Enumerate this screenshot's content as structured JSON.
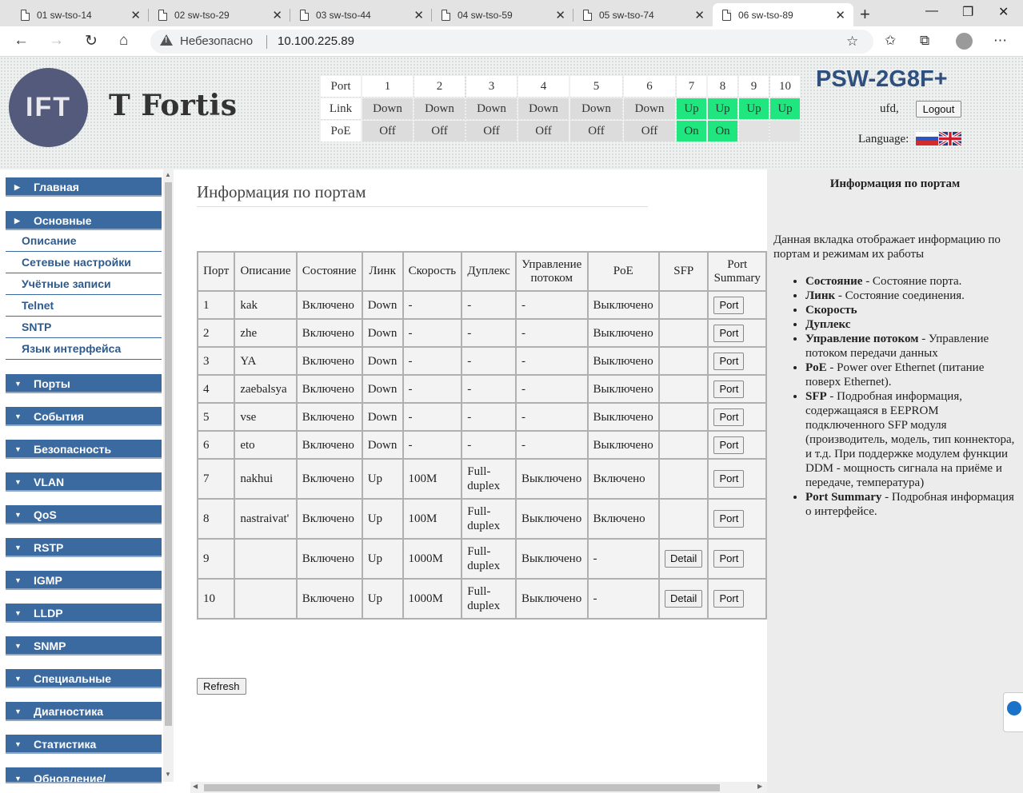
{
  "browser": {
    "tabs": [
      {
        "label": "01 sw-tso-14"
      },
      {
        "label": "02 sw-tso-29"
      },
      {
        "label": "03 sw-tso-44"
      },
      {
        "label": "04 sw-tso-59"
      },
      {
        "label": "05 sw-tso-74"
      },
      {
        "label": "06 sw-tso-89"
      }
    ],
    "security_label": "Небезопасно",
    "url": "10.100.225.89"
  },
  "header": {
    "logo_text": "IFT",
    "brand": "T Fortis",
    "model": "PSW-2G8F+",
    "user": "ufd,",
    "logout": "Logout",
    "language_label": "Language:",
    "port_grid": {
      "row_labels": {
        "port": "Port",
        "link": "Link",
        "poe": "PoE"
      },
      "ports": [
        {
          "num": "1",
          "link": "Down",
          "poe": "Off"
        },
        {
          "num": "2",
          "link": "Down",
          "poe": "Off"
        },
        {
          "num": "3",
          "link": "Down",
          "poe": "Off"
        },
        {
          "num": "4",
          "link": "Down",
          "poe": "Off"
        },
        {
          "num": "5",
          "link": "Down",
          "poe": "Off"
        },
        {
          "num": "6",
          "link": "Down",
          "poe": "Off"
        },
        {
          "num": "7",
          "link": "Up",
          "poe": "On"
        },
        {
          "num": "8",
          "link": "Up",
          "poe": "On"
        },
        {
          "num": "9",
          "link": "Up",
          "poe": ""
        },
        {
          "num": "10",
          "link": "Up",
          "poe": ""
        }
      ]
    }
  },
  "sidebar": {
    "main": "Главная",
    "basic": "Основные",
    "basic_items": [
      "Описание",
      "Сетевые настройки",
      "Учётные записи",
      "Telnet",
      "SNTP",
      "Язык интерфейса"
    ],
    "sections": [
      "Порты",
      "События",
      "Безопасность",
      "VLAN",
      "QoS",
      "RSTP",
      "IGMP",
      "LLDP",
      "SNMP",
      "Специальные",
      "Диагностика",
      "Статистика",
      "Обновление/"
    ]
  },
  "main": {
    "title": "Информация по портам",
    "columns": [
      "Порт",
      "Описание",
      "Состояние",
      "Линк",
      "Скорость",
      "Дуплекс",
      "Управление потоком",
      "PoE",
      "SFP",
      "Port Summary"
    ],
    "detail_label": "Detail",
    "port_label": "Port",
    "rows": [
      {
        "port": "1",
        "desc": "kak",
        "state": "Включено",
        "link": "Down",
        "speed": "-",
        "duplex": "-",
        "flow": "-",
        "poe": "Выключено"
      },
      {
        "port": "2",
        "desc": "zhe",
        "state": "Включено",
        "link": "Down",
        "speed": "-",
        "duplex": "-",
        "flow": "-",
        "poe": "Выключено"
      },
      {
        "port": "3",
        "desc": "YA",
        "state": "Включено",
        "link": "Down",
        "speed": "-",
        "duplex": "-",
        "flow": "-",
        "poe": "Выключено"
      },
      {
        "port": "4",
        "desc": "zaebalsya",
        "state": "Включено",
        "link": "Down",
        "speed": "-",
        "duplex": "-",
        "flow": "-",
        "poe": "Выключено"
      },
      {
        "port": "5",
        "desc": "vse",
        "state": "Включено",
        "link": "Down",
        "speed": "-",
        "duplex": "-",
        "flow": "-",
        "poe": "Выключено"
      },
      {
        "port": "6",
        "desc": "eto",
        "state": "Включено",
        "link": "Down",
        "speed": "-",
        "duplex": "-",
        "flow": "-",
        "poe": "Выключено"
      },
      {
        "port": "7",
        "desc": "nakhui",
        "state": "Включено",
        "link": "Up",
        "speed": "100M",
        "duplex": "Full-duplex",
        "flow": "Выключено",
        "poe": "Включено"
      },
      {
        "port": "8",
        "desc": "nastraivat'",
        "state": "Включено",
        "link": "Up",
        "speed": "100M",
        "duplex": "Full-duplex",
        "flow": "Выключено",
        "poe": "Включено"
      },
      {
        "port": "9",
        "desc": "",
        "state": "Включено",
        "link": "Up",
        "speed": "1000M",
        "duplex": "Full-duplex",
        "flow": "Выключено",
        "poe": "-"
      },
      {
        "port": "10",
        "desc": "",
        "state": "Включено",
        "link": "Up",
        "speed": "1000M",
        "duplex": "Full-duplex",
        "flow": "Выключено",
        "poe": "-"
      }
    ],
    "refresh": "Refresh"
  },
  "help": {
    "title": "Информация по портам",
    "intro": "Данная вкладка отображает информацию по портам и режимам их работы",
    "items": [
      {
        "term": "Состояние",
        "desc": " - Состояние порта."
      },
      {
        "term": "Линк",
        "desc": " - Состояние соединения."
      },
      {
        "term": "Скорость",
        "desc": ""
      },
      {
        "term": "Дуплекс",
        "desc": ""
      },
      {
        "term": "Управление потоком",
        "desc": " - Управление потоком передачи данных"
      },
      {
        "term": "PoE",
        "desc": " - Power over Ethernet (питание поверх Ethernet)."
      },
      {
        "term": "SFP",
        "desc": " - Подробная информация, содержащаяся в EEPROM подключенного SFP модуля (производитель, модель, тип коннектора, и т.д. При поддержке модулем функции DDM - мощность сигнала на приёме и передаче, температура)"
      },
      {
        "term": "Port Summary",
        "desc": " - Подробная информация о интерфейсе."
      }
    ]
  },
  "colors": {
    "link_up": "#1fe67e",
    "sidebar_head": "#3a6aa0",
    "model_text": "#2f4f7f"
  }
}
